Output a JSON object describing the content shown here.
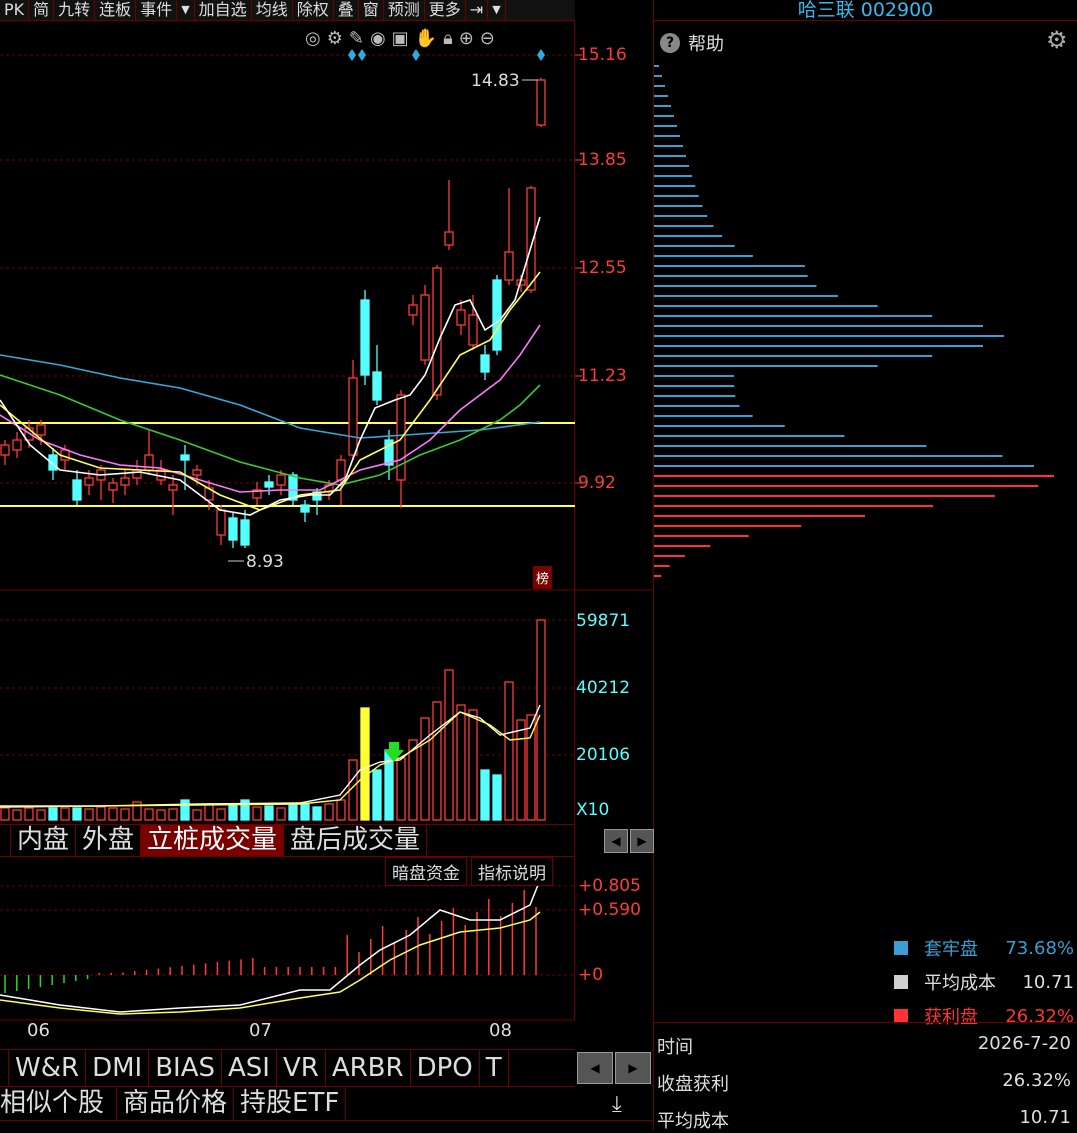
{
  "toolbar": {
    "items": [
      "PK",
      "简",
      "九转",
      "连板",
      "事件",
      "加自选",
      "均线",
      "除权",
      "叠",
      "窗",
      "预测",
      "更多"
    ],
    "dropdown_glyph": "▼"
  },
  "stock": {
    "name_code": "哈三联 002900"
  },
  "help": {
    "label": "帮助"
  },
  "price_axis": {
    "labels": [
      "15.16",
      "13.85",
      "12.55",
      "11.23",
      "9.92"
    ]
  },
  "annotations": {
    "high_label": "14.83",
    "low_label": "8.93",
    "rank_badge": "榜"
  },
  "volume_axis": {
    "labels": [
      "59871",
      "40212",
      "20106",
      "X10"
    ]
  },
  "volume_tabs": [
    "内盘",
    "外盘",
    "立桩成交量",
    "盘后成交量"
  ],
  "macd": {
    "buttons": [
      "暗盘资金",
      "指标说明"
    ],
    "labels": [
      "+0.805",
      "+0.590",
      "+0"
    ]
  },
  "time_axis": {
    "labels": [
      "06",
      "07",
      "08"
    ]
  },
  "indicator_tabs": [
    "W&R",
    "DMI",
    "BIAS",
    "ASI",
    "VR",
    "ARBR",
    "DPO",
    "T"
  ],
  "bottom_tabs": [
    "相似个股",
    "商品价格",
    "持股ETF"
  ],
  "chip_legend": [
    {
      "label": "套牢盘",
      "value": "73.68%",
      "color": "#3a9fd0"
    },
    {
      "label": "平均成本",
      "value": "10.71",
      "color": "#d0d0d0"
    },
    {
      "label": "获利盘",
      "value": "26.32%",
      "color": "#ff3333"
    }
  ],
  "info": [
    {
      "label": "时间",
      "value": "2026-7-20"
    },
    {
      "label": "收盘获利",
      "value": "26.32%"
    },
    {
      "label": "平均成本",
      "value": "10.71"
    }
  ],
  "colors": {
    "up": "#ff3b3b",
    "down": "#55ffff",
    "ma5": "#ffffff",
    "ma10": "#ffff55",
    "ma20": "#ff77ff",
    "ma30": "#33cc33",
    "ma60": "#33aadd",
    "bg": "#000000",
    "border": "#6b0000"
  }
}
